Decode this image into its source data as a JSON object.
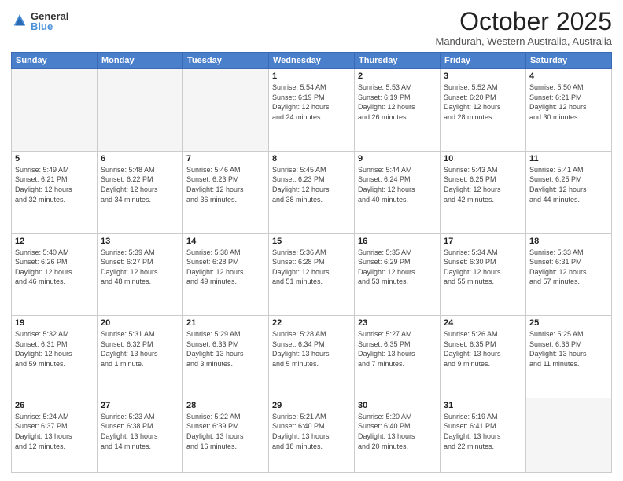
{
  "logo": {
    "general": "General",
    "blue": "Blue"
  },
  "title": "October 2025",
  "subtitle": "Mandurah, Western Australia, Australia",
  "headers": [
    "Sunday",
    "Monday",
    "Tuesday",
    "Wednesday",
    "Thursday",
    "Friday",
    "Saturday"
  ],
  "weeks": [
    [
      {
        "day": "",
        "info": ""
      },
      {
        "day": "",
        "info": ""
      },
      {
        "day": "",
        "info": ""
      },
      {
        "day": "1",
        "info": "Sunrise: 5:54 AM\nSunset: 6:19 PM\nDaylight: 12 hours\nand 24 minutes."
      },
      {
        "day": "2",
        "info": "Sunrise: 5:53 AM\nSunset: 6:19 PM\nDaylight: 12 hours\nand 26 minutes."
      },
      {
        "day": "3",
        "info": "Sunrise: 5:52 AM\nSunset: 6:20 PM\nDaylight: 12 hours\nand 28 minutes."
      },
      {
        "day": "4",
        "info": "Sunrise: 5:50 AM\nSunset: 6:21 PM\nDaylight: 12 hours\nand 30 minutes."
      }
    ],
    [
      {
        "day": "5",
        "info": "Sunrise: 5:49 AM\nSunset: 6:21 PM\nDaylight: 12 hours\nand 32 minutes."
      },
      {
        "day": "6",
        "info": "Sunrise: 5:48 AM\nSunset: 6:22 PM\nDaylight: 12 hours\nand 34 minutes."
      },
      {
        "day": "7",
        "info": "Sunrise: 5:46 AM\nSunset: 6:23 PM\nDaylight: 12 hours\nand 36 minutes."
      },
      {
        "day": "8",
        "info": "Sunrise: 5:45 AM\nSunset: 6:23 PM\nDaylight: 12 hours\nand 38 minutes."
      },
      {
        "day": "9",
        "info": "Sunrise: 5:44 AM\nSunset: 6:24 PM\nDaylight: 12 hours\nand 40 minutes."
      },
      {
        "day": "10",
        "info": "Sunrise: 5:43 AM\nSunset: 6:25 PM\nDaylight: 12 hours\nand 42 minutes."
      },
      {
        "day": "11",
        "info": "Sunrise: 5:41 AM\nSunset: 6:25 PM\nDaylight: 12 hours\nand 44 minutes."
      }
    ],
    [
      {
        "day": "12",
        "info": "Sunrise: 5:40 AM\nSunset: 6:26 PM\nDaylight: 12 hours\nand 46 minutes."
      },
      {
        "day": "13",
        "info": "Sunrise: 5:39 AM\nSunset: 6:27 PM\nDaylight: 12 hours\nand 48 minutes."
      },
      {
        "day": "14",
        "info": "Sunrise: 5:38 AM\nSunset: 6:28 PM\nDaylight: 12 hours\nand 49 minutes."
      },
      {
        "day": "15",
        "info": "Sunrise: 5:36 AM\nSunset: 6:28 PM\nDaylight: 12 hours\nand 51 minutes."
      },
      {
        "day": "16",
        "info": "Sunrise: 5:35 AM\nSunset: 6:29 PM\nDaylight: 12 hours\nand 53 minutes."
      },
      {
        "day": "17",
        "info": "Sunrise: 5:34 AM\nSunset: 6:30 PM\nDaylight: 12 hours\nand 55 minutes."
      },
      {
        "day": "18",
        "info": "Sunrise: 5:33 AM\nSunset: 6:31 PM\nDaylight: 12 hours\nand 57 minutes."
      }
    ],
    [
      {
        "day": "19",
        "info": "Sunrise: 5:32 AM\nSunset: 6:31 PM\nDaylight: 12 hours\nand 59 minutes."
      },
      {
        "day": "20",
        "info": "Sunrise: 5:31 AM\nSunset: 6:32 PM\nDaylight: 13 hours\nand 1 minute."
      },
      {
        "day": "21",
        "info": "Sunrise: 5:29 AM\nSunset: 6:33 PM\nDaylight: 13 hours\nand 3 minutes."
      },
      {
        "day": "22",
        "info": "Sunrise: 5:28 AM\nSunset: 6:34 PM\nDaylight: 13 hours\nand 5 minutes."
      },
      {
        "day": "23",
        "info": "Sunrise: 5:27 AM\nSunset: 6:35 PM\nDaylight: 13 hours\nand 7 minutes."
      },
      {
        "day": "24",
        "info": "Sunrise: 5:26 AM\nSunset: 6:35 PM\nDaylight: 13 hours\nand 9 minutes."
      },
      {
        "day": "25",
        "info": "Sunrise: 5:25 AM\nSunset: 6:36 PM\nDaylight: 13 hours\nand 11 minutes."
      }
    ],
    [
      {
        "day": "26",
        "info": "Sunrise: 5:24 AM\nSunset: 6:37 PM\nDaylight: 13 hours\nand 12 minutes."
      },
      {
        "day": "27",
        "info": "Sunrise: 5:23 AM\nSunset: 6:38 PM\nDaylight: 13 hours\nand 14 minutes."
      },
      {
        "day": "28",
        "info": "Sunrise: 5:22 AM\nSunset: 6:39 PM\nDaylight: 13 hours\nand 16 minutes."
      },
      {
        "day": "29",
        "info": "Sunrise: 5:21 AM\nSunset: 6:40 PM\nDaylight: 13 hours\nand 18 minutes."
      },
      {
        "day": "30",
        "info": "Sunrise: 5:20 AM\nSunset: 6:40 PM\nDaylight: 13 hours\nand 20 minutes."
      },
      {
        "day": "31",
        "info": "Sunrise: 5:19 AM\nSunset: 6:41 PM\nDaylight: 13 hours\nand 22 minutes."
      },
      {
        "day": "",
        "info": ""
      }
    ]
  ]
}
